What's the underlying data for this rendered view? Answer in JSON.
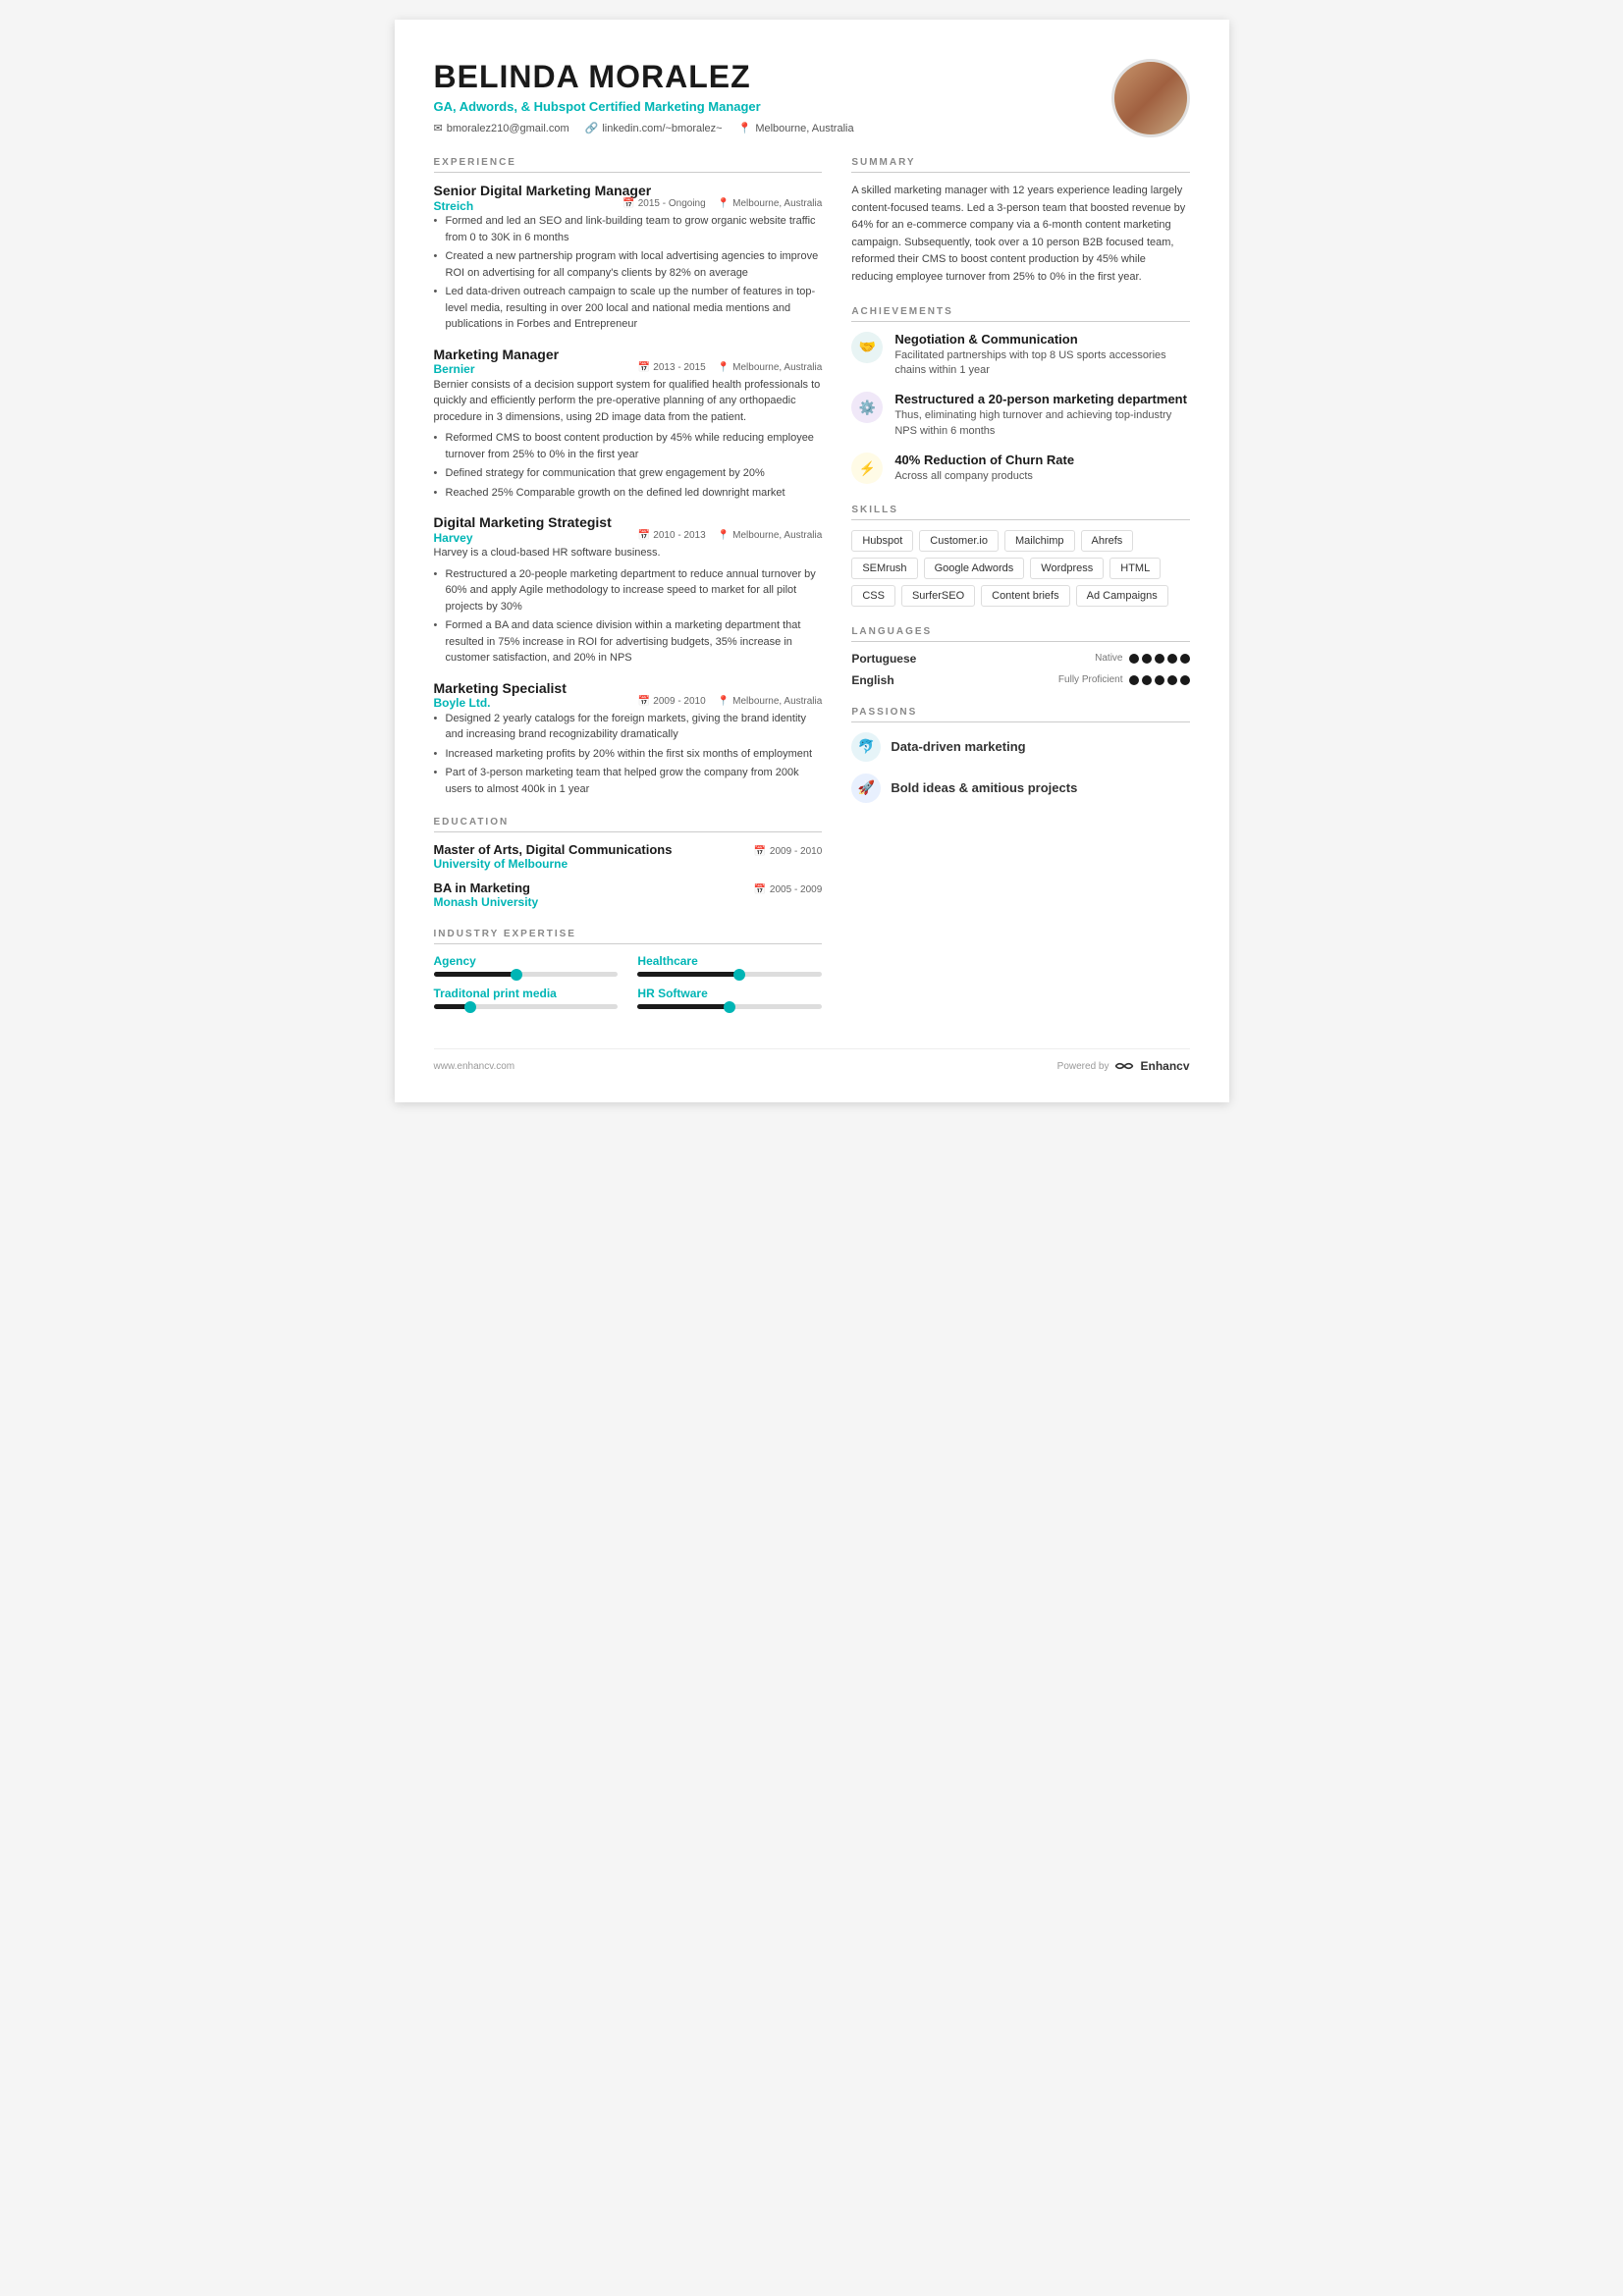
{
  "header": {
    "name": "BELINDA MORALEZ",
    "title": "GA, Adwords, & Hubspot Certified Marketing Manager",
    "email": "bmoralez210@gmail.com",
    "linkedin": "linkedin.com/~bmoralez~",
    "location": "Melbourne, Australia"
  },
  "experience": {
    "section_title": "EXPERIENCE",
    "jobs": [
      {
        "title": "Senior Digital Marketing Manager",
        "company": "Streich",
        "date": "2015 - Ongoing",
        "location": "Melbourne, Australia",
        "description": "",
        "bullets": [
          "Formed and led an SEO and link-building team to grow organic website traffic from 0 to 30K in 6 months",
          "Created a new partnership program with local advertising agencies to improve ROI on advertising for all company's clients by 82% on average",
          "Led data-driven outreach campaign to scale up the number of features in top-level media, resulting in over 200 local and national media mentions and publications in Forbes and Entrepreneur"
        ]
      },
      {
        "title": "Marketing Manager",
        "company": "Bernier",
        "date": "2013 - 2015",
        "location": "Melbourne, Australia",
        "description": "Bernier consists of a decision support system for qualified health professionals to quickly and efficiently perform the pre-operative planning of any orthopaedic procedure in 3 dimensions, using 2D image data from the patient.",
        "bullets": [
          "Reformed CMS to boost content production by 45% while reducing employee turnover from 25% to 0% in the first year",
          "Defined strategy for communication that grew engagement by 20%",
          "Reached 25% Comparable growth on the defined led downright market"
        ]
      },
      {
        "title": "Digital Marketing Strategist",
        "company": "Harvey",
        "date": "2010 - 2013",
        "location": "Melbourne, Australia",
        "description": "Harvey is a cloud-based HR software business.",
        "bullets": [
          "Restructured a 20-people marketing department to reduce annual turnover by 60% and apply Agile methodology to increase speed to market for all pilot projects by 30%",
          "Formed a BA and data science division within a marketing department that resulted in 75% increase in ROI for advertising budgets, 35% increase in customer satisfaction, and 20% in NPS"
        ]
      },
      {
        "title": "Marketing Specialist",
        "company": "Boyle Ltd.",
        "date": "2009 - 2010",
        "location": "Melbourne, Australia",
        "description": "",
        "bullets": [
          "Designed 2 yearly catalogs for the foreign markets, giving the brand identity and increasing brand recognizability dramatically",
          "Increased marketing profits by 20% within the first six months of employment",
          "Part of 3-person marketing team that helped grow the company from 200k users to almost 400k in 1 year"
        ]
      }
    ]
  },
  "education": {
    "section_title": "EDUCATION",
    "items": [
      {
        "degree": "Master of Arts, Digital Communications",
        "school": "University of Melbourne",
        "date": "2009 - 2010"
      },
      {
        "degree": "BA in Marketing",
        "school": "Monash University",
        "date": "2005 - 2009"
      }
    ]
  },
  "industry_expertise": {
    "section_title": "INDUSTRY EXPERTISE",
    "items": [
      {
        "label": "Agency",
        "fill_pct": 45
      },
      {
        "label": "Healthcare",
        "fill_pct": 55
      },
      {
        "label": "Traditonal print media",
        "fill_pct": 20
      },
      {
        "label": "HR Software",
        "fill_pct": 50
      }
    ]
  },
  "summary": {
    "section_title": "SUMMARY",
    "text": "A skilled marketing manager with 12 years experience leading largely content-focused teams. Led a 3-person team that boosted revenue by 64% for an e-commerce company via a 6-month content marketing campaign. Subsequently, took over a 10 person B2B focused team, reformed their CMS to boost content production by 45% while reducing employee turnover from 25% to 0% in the first year."
  },
  "achievements": {
    "section_title": "ACHIEVEMENTS",
    "items": [
      {
        "icon": "🤝",
        "icon_bg": "#e8f4f4",
        "title": "Negotiation & Communication",
        "desc": "Facilitated partnerships with top 8 US sports accessories chains within 1 year"
      },
      {
        "icon": "⚙️",
        "icon_bg": "#f0e8f8",
        "title": "Restructured a 20-person marketing department",
        "desc": "Thus, eliminating high turnover and achieving top-industry NPS within 6 months"
      },
      {
        "icon": "⚡",
        "icon_bg": "#fffbe6",
        "title": "40% Reduction of Churn Rate",
        "desc": "Across all company products"
      }
    ]
  },
  "skills": {
    "section_title": "SKILLS",
    "items": [
      "Hubspot",
      "Customer.io",
      "Mailchimp",
      "Ahrefs",
      "SEMrush",
      "Google Adwords",
      "Wordpress",
      "HTML",
      "CSS",
      "SurferSEO",
      "Content briefs",
      "Ad Campaigns"
    ]
  },
  "languages": {
    "section_title": "LANGUAGES",
    "items": [
      {
        "name": "Portuguese",
        "level": "Native",
        "dots": 5,
        "filled": 5
      },
      {
        "name": "English",
        "level": "Fully Proficient",
        "dots": 5,
        "filled": 5
      }
    ]
  },
  "passions": {
    "section_title": "PASSIONS",
    "items": [
      {
        "icon": "🐬",
        "icon_bg": "#e6f4f8",
        "text": "Data-driven marketing"
      },
      {
        "icon": "🚀",
        "icon_bg": "#e8f0fe",
        "text": "Bold ideas & amitious projects"
      }
    ]
  },
  "footer": {
    "website": "www.enhancv.com",
    "powered_by": "Powered by",
    "brand": "Enhancv"
  }
}
